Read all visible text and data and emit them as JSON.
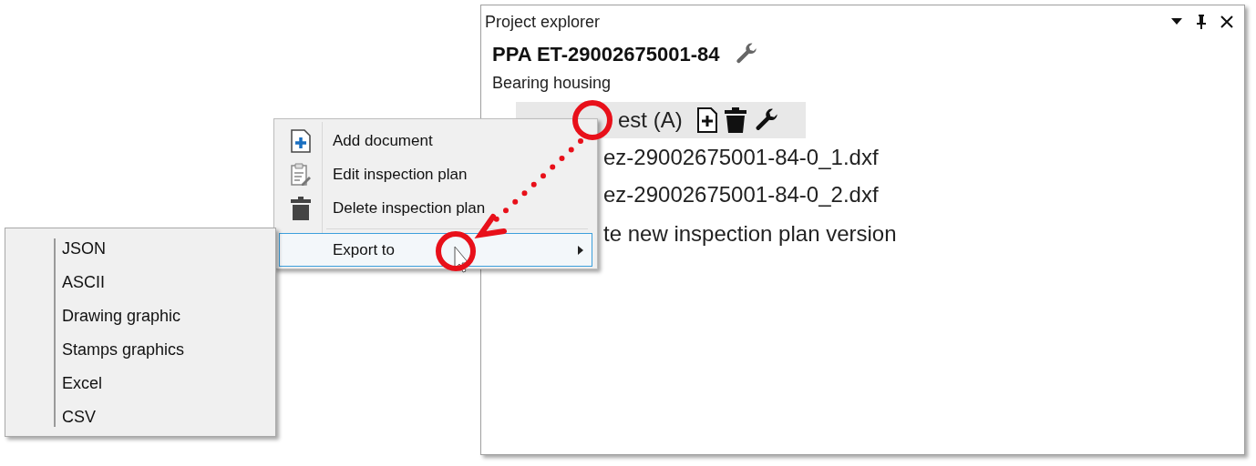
{
  "panel": {
    "title": "Project explorer",
    "project_title": "PPA ET-29002675001-84",
    "subtitle": "Bearing housing",
    "tree_item": {
      "label": "est (A)"
    },
    "files": [
      "ez-29002675001-84-0_1.dxf",
      "ez-29002675001-84-0_2.dxf"
    ],
    "create_item": "te new inspection plan version"
  },
  "context_menu": {
    "items": [
      {
        "kind": "add",
        "label": "Add document",
        "selected": false
      },
      {
        "kind": "edit",
        "label": "Edit inspection plan",
        "selected": false
      },
      {
        "kind": "delete",
        "label": "Delete inspection plan",
        "selected": false
      },
      {
        "kind": "submenu",
        "label": "Export to",
        "selected": true
      }
    ]
  },
  "submenu": {
    "items": [
      "JSON",
      "ASCII",
      "Drawing graphic",
      "Stamps graphics",
      "Excel",
      "CSV"
    ]
  }
}
